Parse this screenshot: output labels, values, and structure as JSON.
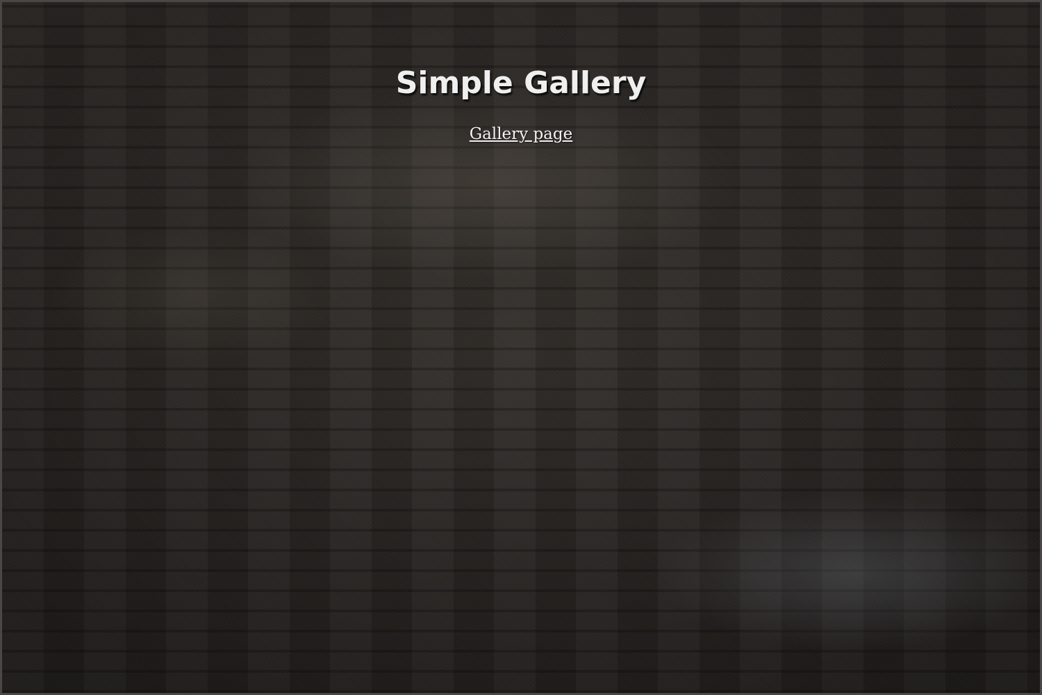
{
  "page": {
    "title": "Simple Gallery",
    "link_label": "Gallery page"
  },
  "colors": {
    "background": "#2e2a27",
    "text": "#efefef"
  }
}
